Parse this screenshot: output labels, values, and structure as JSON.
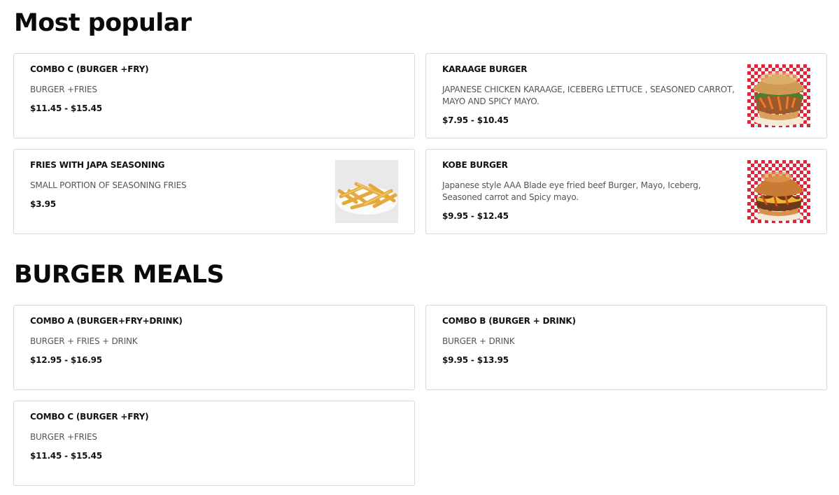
{
  "sections": [
    {
      "title": "Most popular",
      "items": [
        {
          "name": "COMBO C (BURGER +FRY)",
          "description": "BURGER +FRIES",
          "price": "$11.45 - $15.45",
          "image": null
        },
        {
          "name": "KARAAGE BURGER",
          "description": "JAPANESE CHICKEN KARAAGE, ICEBERG LETTUCE , SEASONED CARROT, MAYO AND SPICY MAYO.",
          "price": "$7.95 - $10.45",
          "image": "karaage-burger-photo"
        },
        {
          "name": "FRIES WITH JAPA SEASONING",
          "description": "SMALL PORTION OF SEASONING FRIES",
          "price": "$3.95",
          "image": "fries-photo"
        },
        {
          "name": "KOBE BURGER",
          "description": "Japanese style AAA Blade eye fried beef Burger, Mayo, Iceberg, Seasoned carrot and Spicy mayo.",
          "price": "$9.95 - $12.45",
          "image": "kobe-burger-photo"
        }
      ]
    },
    {
      "title": "BURGER MEALS",
      "items": [
        {
          "name": "COMBO A (BURGER+FRY+DRINK)",
          "description": "BURGER + FRIES + DRINK",
          "price": "$12.95 - $16.95",
          "image": null
        },
        {
          "name": "COMBO B (BURGER + DRINK)",
          "description": "BURGER + DRINK",
          "price": "$9.95 - $13.95",
          "image": null
        },
        {
          "name": "COMBO C (BURGER +FRY)",
          "description": "BURGER +FRIES",
          "price": "$11.45 - $15.45",
          "image": null
        }
      ]
    }
  ],
  "colors": {
    "card_border": "#d9d9d9",
    "text_primary": "#111111",
    "text_secondary": "#545454",
    "checker_red": "#e0243a",
    "checker_white": "#ffffff"
  }
}
